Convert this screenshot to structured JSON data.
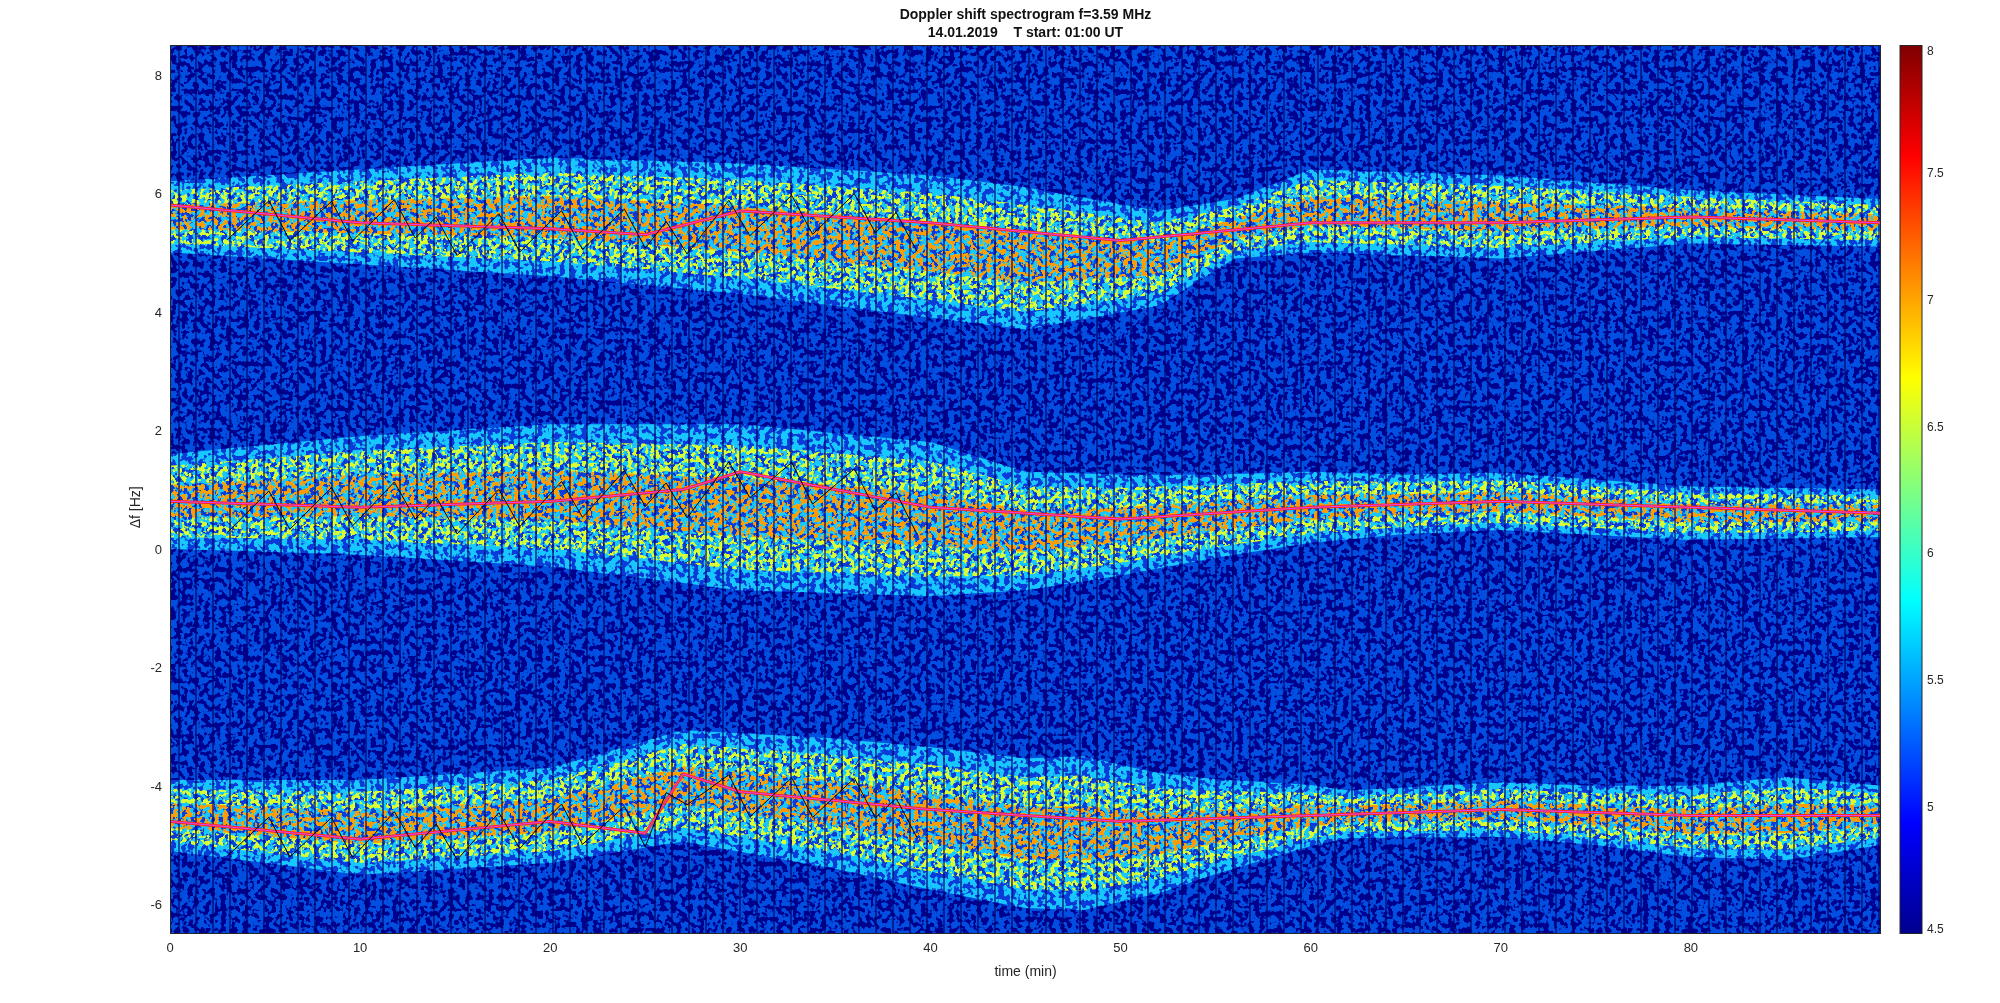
{
  "figure": {
    "title_lines": [
      "Doppler shift spectrogram f=3.59 MHz",
      "14.01.2019    T start: 01:00 UT"
    ],
    "x_axis": {
      "label": "time (min)",
      "ticks": [
        "0",
        "10",
        "20",
        "30",
        "40",
        "50",
        "60",
        "70",
        "80"
      ]
    },
    "y_axis": {
      "label": "Δf [Hz]",
      "ticks": [
        "8",
        "6",
        "4",
        "2",
        "0",
        "-2",
        "-4",
        "-6"
      ]
    },
    "colorbar": {
      "ticks": [
        "8",
        "7.5",
        "7",
        "6.5",
        "6",
        "5.5",
        "5",
        "4.5"
      ]
    }
  }
}
